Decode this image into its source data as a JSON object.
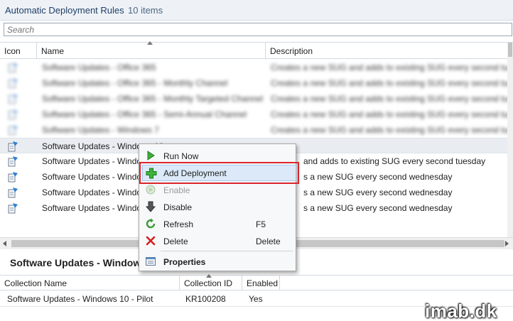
{
  "title": {
    "main": "Automatic Deployment Rules",
    "count": "10 items"
  },
  "search": {
    "placeholder": "Search"
  },
  "columns": {
    "icon": "Icon",
    "name": "Name",
    "description": "Description"
  },
  "rows": [
    {
      "name": "Software Updates - Office 365",
      "description": "Creates a new SUG and adds to existing SUG every second tuesday",
      "blurred": true
    },
    {
      "name": "Software Updates - Office 365 - Monthly Channel",
      "description": "Creates a new SUG and adds to existing SUG every second tuesday",
      "blurred": true
    },
    {
      "name": "Software Updates - Office 365 - Monthly Targeted Channel",
      "description": "Creates a new SUG and adds to existing SUG every second tuesday",
      "blurred": true
    },
    {
      "name": "Software Updates - Office 365 - Semi-Annual Channel",
      "description": "Creates a new SUG and adds to existing SUG every second tuesday",
      "blurred": true
    },
    {
      "name": "Software Updates - Windows 7",
      "description": "Creates a new SUG and adds to existing SUG every second tuesday",
      "blurred": true
    },
    {
      "name": "Software Updates - Windows 10",
      "description": "",
      "blurred": false,
      "selected": true
    },
    {
      "name": "Software Updates - Windo",
      "description": "and adds to existing SUG every second tuesday",
      "blurred": false
    },
    {
      "name": "Software Updates - Windo",
      "description": "s a new SUG every second wednesday",
      "blurred": false
    },
    {
      "name": "Software Updates - Windo",
      "description": "s a new SUG every second wednesday",
      "blurred": false
    },
    {
      "name": "Software Updates - Windo",
      "description": "s a new SUG every second wednesday",
      "blurred": false
    }
  ],
  "context_menu": {
    "items": [
      {
        "id": "run-now",
        "label": "Run Now",
        "icon": "play-icon",
        "shortcut": ""
      },
      {
        "id": "add-deployment",
        "label": "Add Deployment",
        "icon": "plus-icon",
        "shortcut": "",
        "highlighted": true
      },
      {
        "id": "enable",
        "label": "Enable",
        "icon": "enable-icon",
        "shortcut": "",
        "disabled": true
      },
      {
        "id": "disable",
        "label": "Disable",
        "icon": "down-arrow-icon",
        "shortcut": ""
      },
      {
        "id": "refresh",
        "label": "Refresh",
        "icon": "refresh-icon",
        "shortcut": "F5"
      },
      {
        "id": "delete",
        "label": "Delete",
        "icon": "delete-x-icon",
        "shortcut": "Delete"
      },
      {
        "id": "properties",
        "label": "Properties",
        "icon": "properties-icon",
        "shortcut": "",
        "bold": true
      }
    ]
  },
  "detail": {
    "title": "Software Updates - Windows",
    "columns": {
      "collection_name": "Collection Name",
      "collection_id": "Collection ID",
      "enabled": "Enabled"
    },
    "rows": [
      {
        "collection_name": "Software Updates - Windows 10 - Pilot",
        "collection_id": "KR100208",
        "enabled": "Yes"
      }
    ]
  },
  "watermark": "imab.dk",
  "colors": {
    "highlight_border": "#d9262c",
    "menu_highlight": "#dbe9f8",
    "title_text": "#1f3f66"
  }
}
